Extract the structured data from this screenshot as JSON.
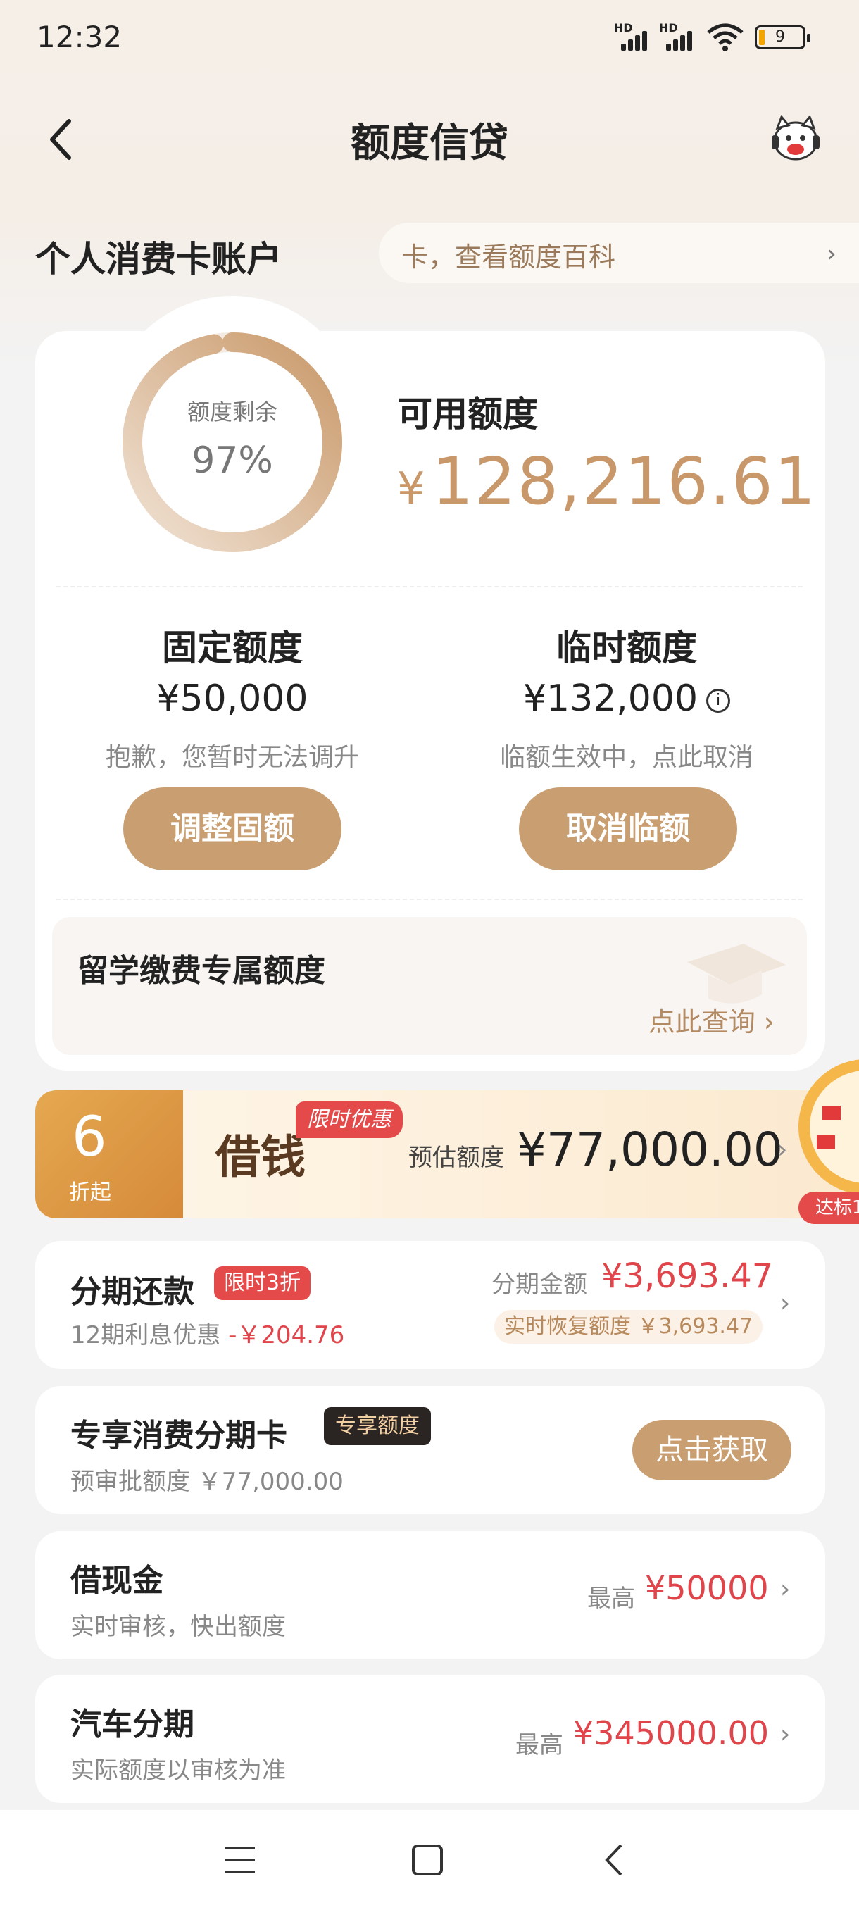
{
  "status": {
    "time": "12:32",
    "battery": "9"
  },
  "header": {
    "title": "额度信贷"
  },
  "account": {
    "title": "个人消费卡账户",
    "ticker": "卡，查看额度百科"
  },
  "limit": {
    "ring_label": "额度剩余",
    "ring_percent": "97%",
    "ring_fraction": 0.97,
    "available_label": "可用额度",
    "currency": "¥",
    "available_amount": "128,216.61"
  },
  "fixed": {
    "title": "固定额度",
    "amount": "¥50,000",
    "sub": "抱歉，您暂时无法调升",
    "button": "调整固额"
  },
  "temp": {
    "title": "临时额度",
    "amount": "¥132,000",
    "info": "i",
    "sub": "临额生效中，点此取消",
    "button": "取消临额"
  },
  "study": {
    "title": "留学缴费专属额度",
    "query": "点此查询 ›"
  },
  "promo": {
    "discount_num": "6",
    "discount_sub": "折起",
    "title": "借钱",
    "tag": "限时优惠",
    "est_label": "预估额度",
    "est_amount": "¥77,000.00",
    "wheel_tag": "达标1"
  },
  "installment": {
    "title": "分期还款",
    "badge": "限时3折",
    "sub": "12期利息优惠",
    "discount": "-￥204.76",
    "amount_label": "分期金额",
    "amount": "¥3,693.47",
    "recover": "实时恢复额度 ￥3,693.47"
  },
  "exclusive": {
    "title": "专享消费分期卡",
    "badge": "专享额度",
    "sub": "预审批额度 ￥77,000.00",
    "button": "点击获取"
  },
  "cash": {
    "title": "借现金",
    "sub": "实时审核，快出额度",
    "prefix": "最高",
    "amount": "¥50000"
  },
  "car": {
    "title": "汽车分期",
    "sub": "实际额度以审核为准",
    "prefix": "最高",
    "amount": "¥345000.00"
  },
  "colors": {
    "gold": "#c99e71",
    "red": "#e0454c",
    "dark": "#222222"
  }
}
